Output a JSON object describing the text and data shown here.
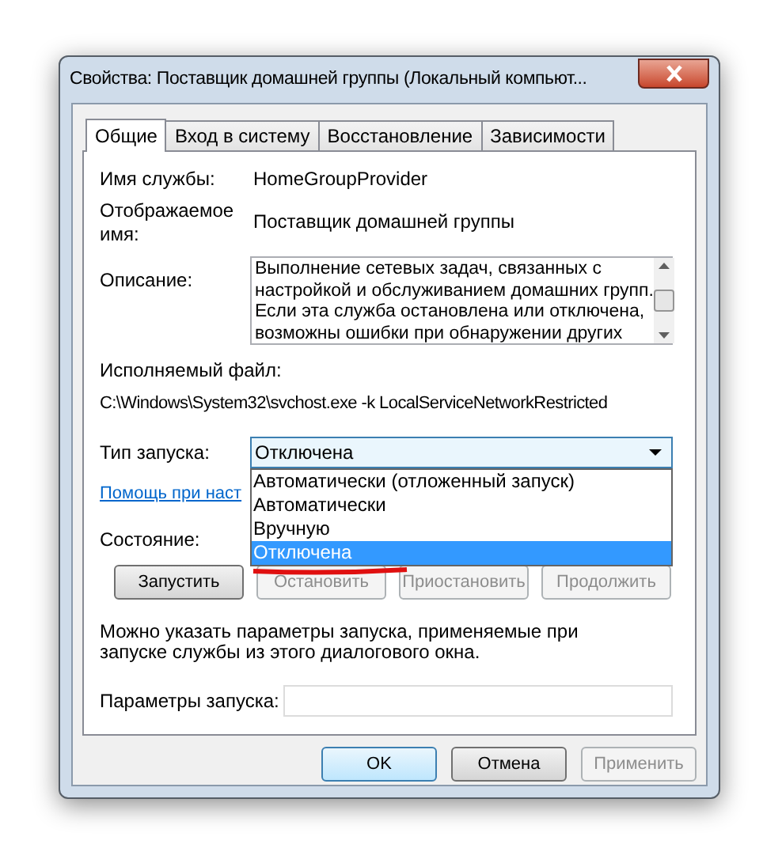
{
  "window": {
    "title": "Свойства: Поставщик домашней группы (Локальный компьют..."
  },
  "tabs": [
    {
      "label": "Общие",
      "selected": true
    },
    {
      "label": "Вход в систему",
      "selected": false
    },
    {
      "label": "Восстановление",
      "selected": false
    },
    {
      "label": "Зависимости",
      "selected": false
    }
  ],
  "service_name": {
    "label": "Имя службы:",
    "value": "HomeGroupProvider"
  },
  "display_name": {
    "label": "Отображаемое имя:",
    "value": "Поставщик домашней группы"
  },
  "description": {
    "label": "Описание:",
    "lines": [
      "Выполнение сетевых задач, связанных с",
      "настройкой и обслуживанием домашних групп.",
      "Если эта служба остановлена или отключена,",
      "возможны ошибки при обнаружении других"
    ]
  },
  "executable": {
    "label": "Исполняемый файл:",
    "path": "C:\\Windows\\System32\\svchost.exe -k LocalServiceNetworkRestricted"
  },
  "startup_type": {
    "label": "Тип запуска:",
    "value": "Отключена",
    "expanded": true,
    "options": [
      {
        "label": "Автоматически (отложенный запуск)",
        "selected": false
      },
      {
        "label": "Автоматически",
        "selected": false
      },
      {
        "label": "Вручную",
        "selected": false
      },
      {
        "label": "Отключена",
        "selected": true
      }
    ]
  },
  "help_link": "Помощь при наст",
  "status": {
    "label": "Состояние:"
  },
  "service_buttons": [
    {
      "label": "Запустить",
      "disabled": false
    },
    {
      "label": "Остановить",
      "disabled": true
    },
    {
      "label": "Приостановить",
      "disabled": true
    },
    {
      "label": "Продолжить",
      "disabled": true
    }
  ],
  "note": "Можно указать параметры запуска, применяемые при запуске службы из этого диалогового окна.",
  "start_params": {
    "label": "Параметры запуска:"
  },
  "buttons": [
    {
      "label": "OK",
      "disabled": false,
      "default": true
    },
    {
      "label": "Отмена",
      "disabled": false,
      "default": false
    },
    {
      "label": "Применить",
      "disabled": true,
      "default": false
    }
  ]
}
